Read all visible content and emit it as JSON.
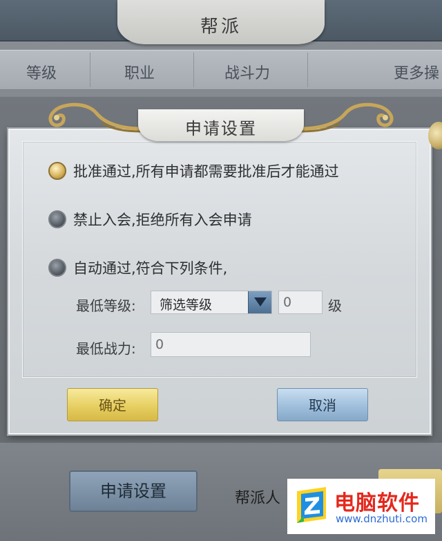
{
  "background": {
    "title": "帮派",
    "columns": [
      "等级",
      "职业",
      "战斗力",
      "更多操"
    ],
    "apply_settings_button": "申请设置",
    "members_label": "帮派人"
  },
  "dialog": {
    "title": "申请设置",
    "options": [
      {
        "label": "批准通过,所有申请都需要批准后才能通过",
        "selected": true
      },
      {
        "label": "禁止入会,拒绝所有入会申请",
        "selected": false
      },
      {
        "label": "自动通过,符合下列条件,",
        "selected": false
      }
    ],
    "min_level_label": "最低等级:",
    "level_filter_value": "筛选等级",
    "level_input_value": "0",
    "level_unit": "级",
    "min_power_label": "最低战力:",
    "power_input_value": "0",
    "confirm_button": "确定",
    "cancel_button": "取消"
  },
  "watermark": {
    "title": "电脑软件",
    "url": "www.dnzhuti.com"
  },
  "colors": {
    "confirm": "#e7cf62",
    "cancel": "#9fbfdc",
    "watermark_red": "#e4281d",
    "watermark_blue": "#2b6bd6"
  }
}
